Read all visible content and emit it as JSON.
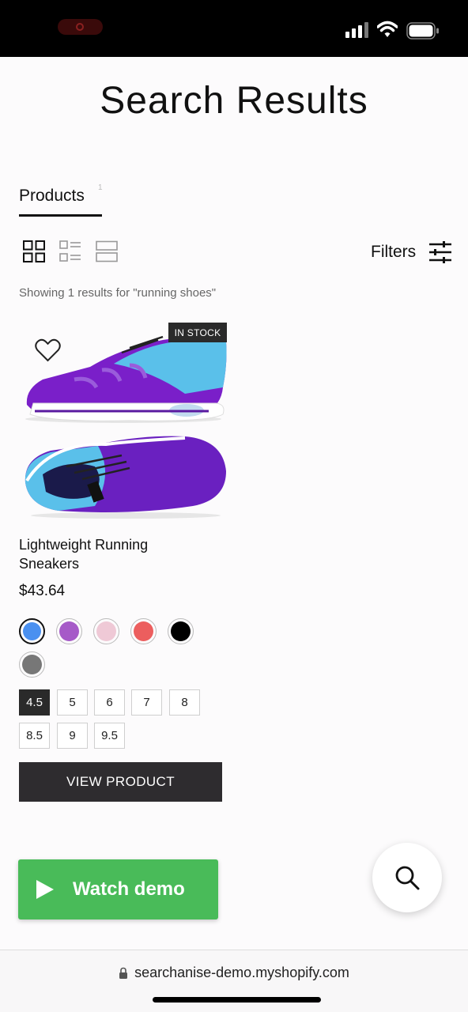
{
  "status_bar": {
    "icons": [
      "screen-record-icon",
      "cellular-signal-icon",
      "wifi-icon",
      "battery-icon"
    ]
  },
  "page": {
    "title": "Search Results"
  },
  "tabs": [
    {
      "label": "Products",
      "count": "1",
      "active": true
    }
  ],
  "toolbar": {
    "view_modes": [
      "grid-view-icon",
      "list-view-icon",
      "wide-view-icon"
    ],
    "filters_label": "Filters",
    "filters_icon": "sliders-icon"
  },
  "results": {
    "summary": "Showing 1 results for \"running shoes\""
  },
  "product": {
    "badge": "IN STOCK",
    "name": "Lightweight Running Sneakers",
    "price": "$43.64",
    "image_icon": "sneaker-image",
    "wishlist_icon": "heart-icon",
    "colors": [
      "#4a90f0",
      "#a65ac8",
      "#efc9d6",
      "#ec5e5e",
      "#000000",
      "#777777"
    ],
    "selected_color_index": 0,
    "sizes": [
      "4.5",
      "5",
      "6",
      "7",
      "8",
      "8.5",
      "9",
      "9.5"
    ],
    "selected_size": "4.5",
    "cta_label": "VIEW PRODUCT"
  },
  "demo_button": {
    "label": "Watch demo",
    "icon": "play-icon",
    "color": "#49bb59"
  },
  "search_fab": {
    "icon": "search-icon"
  },
  "browser": {
    "url": "searchanise-demo.myshopify.com",
    "lock_icon": "lock-icon"
  }
}
